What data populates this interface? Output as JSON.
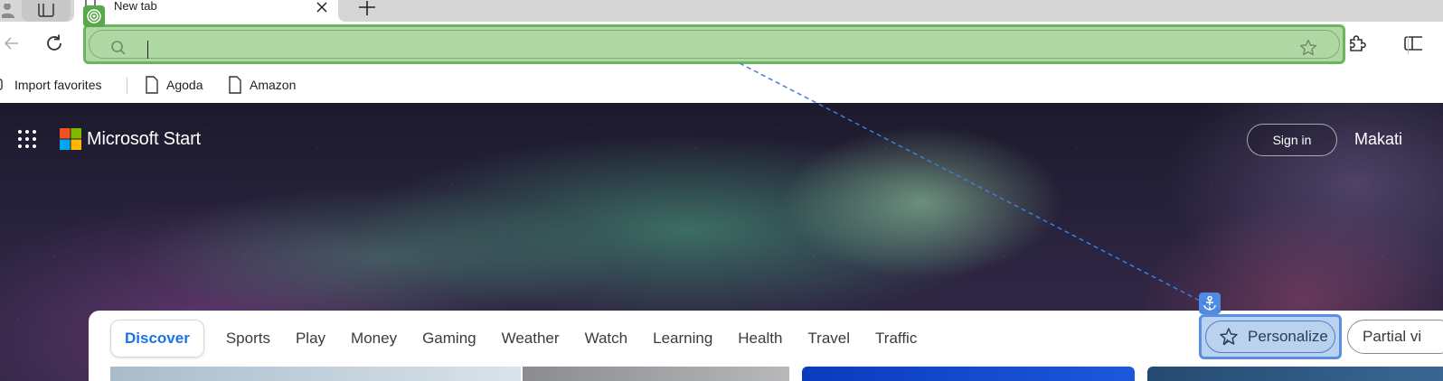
{
  "browser": {
    "tab": {
      "title": "New tab"
    },
    "address_bar": {
      "value": "",
      "placeholder": ""
    },
    "favorites": [
      {
        "label": "Import favorites"
      },
      {
        "label": "Agoda"
      },
      {
        "label": "Amazon"
      }
    ]
  },
  "page": {
    "brand": "Microsoft Start",
    "sign_in_label": "Sign in",
    "location": "Makati",
    "nav_tabs": [
      {
        "label": "Discover",
        "active": true
      },
      {
        "label": "Sports"
      },
      {
        "label": "Play"
      },
      {
        "label": "Money"
      },
      {
        "label": "Gaming"
      },
      {
        "label": "Weather"
      },
      {
        "label": "Watch"
      },
      {
        "label": "Learning"
      },
      {
        "label": "Health"
      },
      {
        "label": "Travel"
      },
      {
        "label": "Traffic"
      }
    ],
    "personalize_label": "Personalize",
    "partial_view_label": "Partial vi"
  },
  "colors": {
    "target_highlight": "#b0d8a4",
    "anchor_highlight": "#bad2ef",
    "active_tab_text": "#1a73e8"
  },
  "icons": {
    "profile": "profile-icon",
    "workspaces": "workspaces-icon",
    "back": "back-arrow-icon",
    "refresh": "refresh-icon",
    "search": "search-icon",
    "favorite": "star-icon",
    "extensions": "puzzle-icon",
    "split_screen": "split-screen-icon",
    "apps": "apps-grid-icon",
    "target": "target-icon",
    "anchor": "anchor-icon"
  }
}
